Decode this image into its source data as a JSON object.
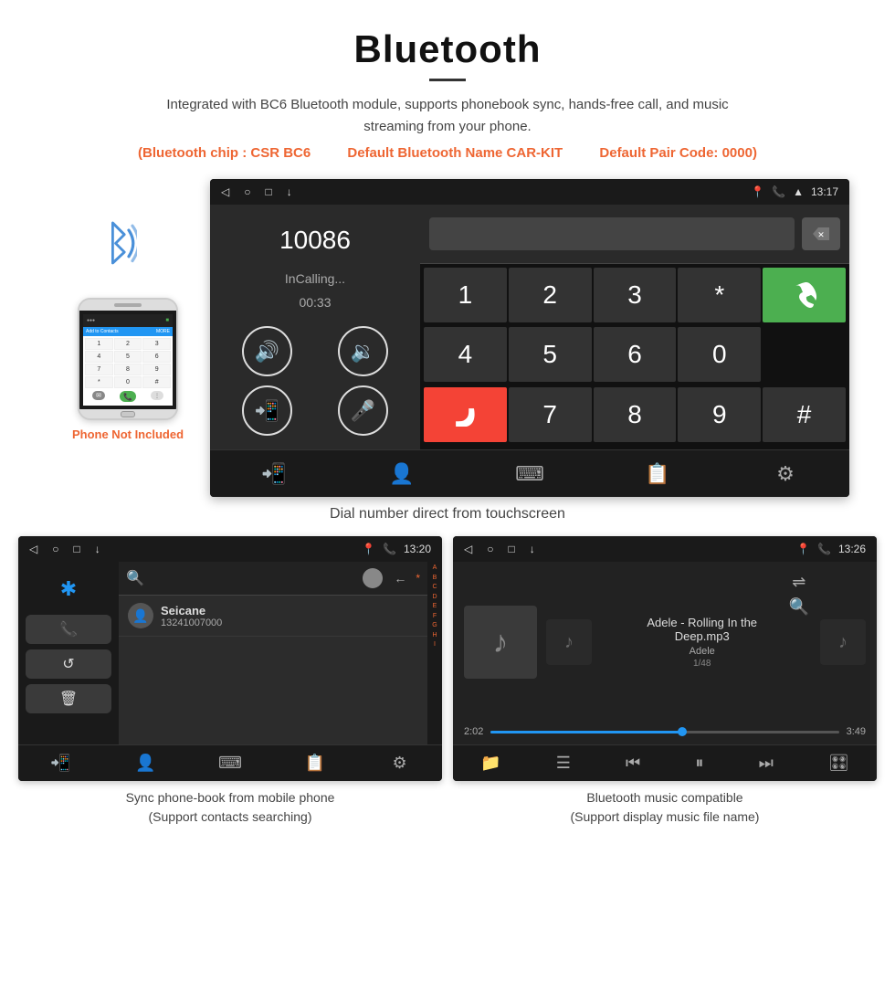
{
  "page": {
    "title": "Bluetooth",
    "divider": true,
    "description": "Integrated with BC6 Bluetooth module, supports phonebook sync, hands-free call, and music streaming from your phone.",
    "specs": [
      "(Bluetooth chip : CSR BC6",
      "Default Bluetooth Name CAR-KIT",
      "Default Pair Code: 0000)"
    ]
  },
  "main_screen": {
    "status_bar": {
      "nav_back": "◁",
      "nav_home": "○",
      "nav_square": "□",
      "nav_download": "↓",
      "location": "📍",
      "phone": "📞",
      "wifi": "▲",
      "time": "13:17"
    },
    "number": "10086",
    "call_status": "InCalling...",
    "timer": "00:33",
    "numpad": [
      "1",
      "2",
      "3",
      "*",
      "4",
      "5",
      "6",
      "0",
      "7",
      "8",
      "9",
      "#"
    ],
    "call_btn": "📞",
    "end_btn": "📵"
  },
  "caption_main": "Dial number direct from touchscreen",
  "phonebook_screen": {
    "status_time": "13:20",
    "contact_name": "Seicane",
    "contact_number": "13241007000",
    "alpha_letters": [
      "A",
      "B",
      "C",
      "D",
      "E",
      "F",
      "G",
      "H",
      "I"
    ]
  },
  "music_screen": {
    "status_time": "13:26",
    "song": "Adele - Rolling In the Deep.mp3",
    "artist": "Adele",
    "track_pos": "1/48",
    "time_current": "2:02",
    "time_total": "3:49",
    "progress_pct": 55
  },
  "caption_phonebook": "Sync phone-book from mobile phone\n(Support contacts searching)",
  "caption_music": "Bluetooth music compatible\n(Support display music file name)",
  "phone_not_included": "Phone Not Included"
}
